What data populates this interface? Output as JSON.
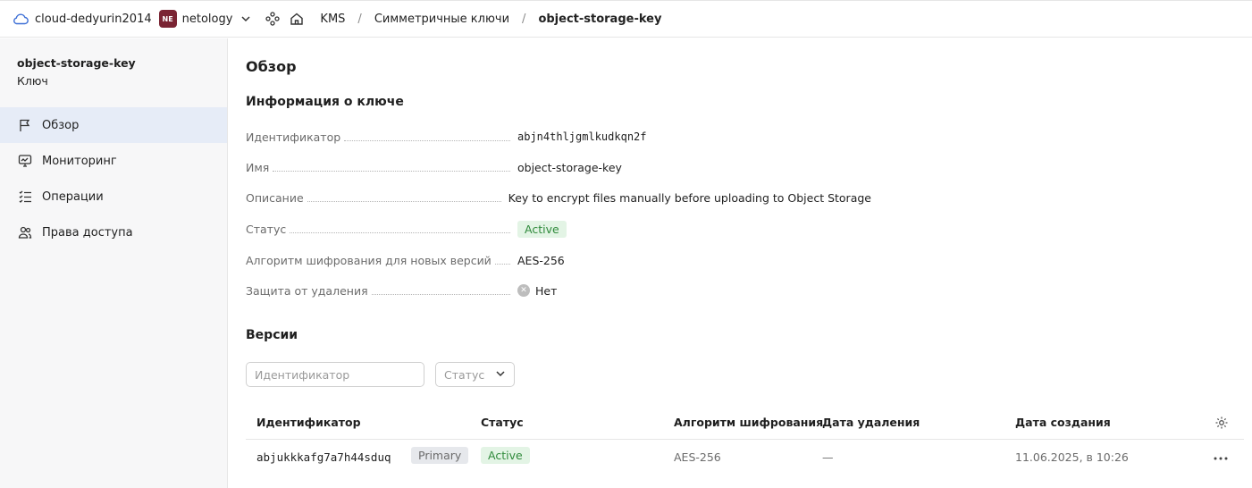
{
  "topbar": {
    "cloud_name": "cloud-dedyurin2014",
    "org_badge": "NE",
    "org_badge_color": "#7a2433",
    "org_name": "netology",
    "breadcrumbs": [
      "KMS",
      "Симметричные ключи",
      "object-storage-key"
    ],
    "separator": "/"
  },
  "sidebar": {
    "resource_name": "object-storage-key",
    "resource_type": "Ключ",
    "items": [
      {
        "label": "Обзор",
        "icon": "flag-icon",
        "active": true
      },
      {
        "label": "Мониторинг",
        "icon": "monitoring-icon",
        "active": false
      },
      {
        "label": "Операции",
        "icon": "operations-icon",
        "active": false
      },
      {
        "label": "Права доступа",
        "icon": "users-icon",
        "active": false
      }
    ]
  },
  "main": {
    "title": "Обзор",
    "info_title": "Информация о ключе",
    "props": [
      {
        "key": "Идентификатор",
        "value": "abjn4thljgmlkudkqn2f"
      },
      {
        "key": "Имя",
        "value": "object-storage-key"
      },
      {
        "key": "Описание",
        "value": "Key to encrypt files manually before uploading to Object Storage"
      },
      {
        "key": "Статус",
        "value": "Active"
      },
      {
        "key": "Алгоритм шифрования для новых версий",
        "value": "AES-256"
      },
      {
        "key": "Защита от удаления",
        "value": "Нет"
      }
    ],
    "versions_title": "Версии",
    "filter_placeholder": "Идентификатор",
    "status_select_placeholder": "Статус",
    "table": {
      "columns": [
        "Идентификатор",
        "Статус",
        "Алгоритм шифрования",
        "Дата удаления",
        "Дата создания"
      ],
      "rows": [
        {
          "id": "abjukkkafg7a7h44sduq",
          "badge": "Primary",
          "status": "Active",
          "algorithm": "AES-256",
          "deleted": "—",
          "created": "11.06.2025, в 10:26"
        }
      ]
    }
  },
  "colors": {
    "accent": "#3d6fd6",
    "active_bg": "#e3f4e5",
    "active_text": "#2f8a3b",
    "sidebar_bg": "#f7f7f8",
    "nav_active_bg": "#e6ecf7"
  }
}
